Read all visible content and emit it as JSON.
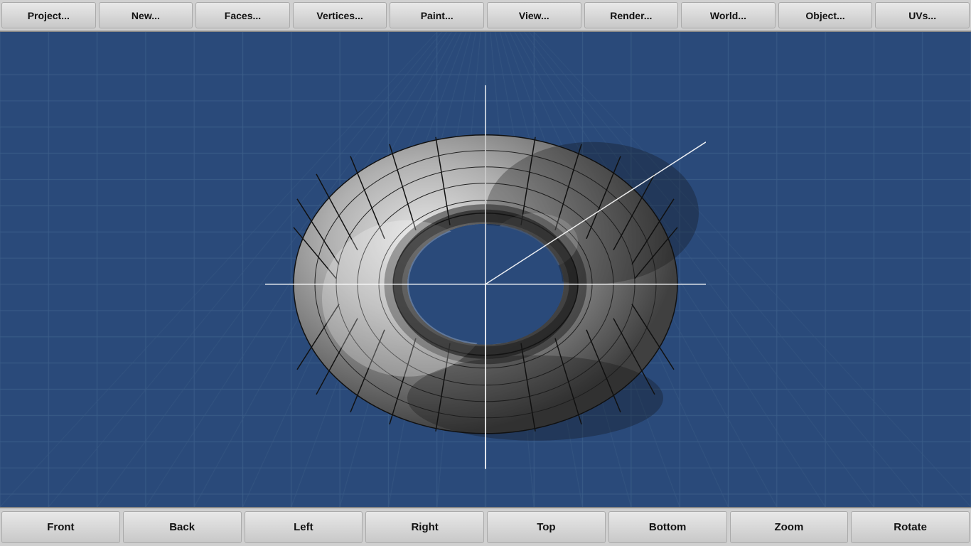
{
  "toolbar_top": {
    "buttons": [
      {
        "label": "Project...",
        "name": "project-button"
      },
      {
        "label": "New...",
        "name": "new-button"
      },
      {
        "label": "Faces...",
        "name": "faces-button"
      },
      {
        "label": "Vertices...",
        "name": "vertices-button"
      },
      {
        "label": "Paint...",
        "name": "paint-button"
      },
      {
        "label": "View...",
        "name": "view-button"
      },
      {
        "label": "Render...",
        "name": "render-button"
      },
      {
        "label": "World...",
        "name": "world-button"
      },
      {
        "label": "Object...",
        "name": "object-button"
      },
      {
        "label": "UVs...",
        "name": "uvs-button"
      }
    ]
  },
  "toolbar_bottom": {
    "buttons": [
      {
        "label": "Front",
        "name": "front-button"
      },
      {
        "label": "Back",
        "name": "back-button"
      },
      {
        "label": "Left",
        "name": "left-button"
      },
      {
        "label": "Right",
        "name": "right-button"
      },
      {
        "label": "Top",
        "name": "top-button"
      },
      {
        "label": "Bottom",
        "name": "bottom-button"
      },
      {
        "label": "Zoom",
        "name": "zoom-button"
      },
      {
        "label": "Rotate",
        "name": "rotate-button"
      }
    ]
  },
  "viewport": {
    "background_color": "#2a4a7a",
    "grid_color": "#3a5a8a",
    "axis_color": "#ffffff"
  }
}
